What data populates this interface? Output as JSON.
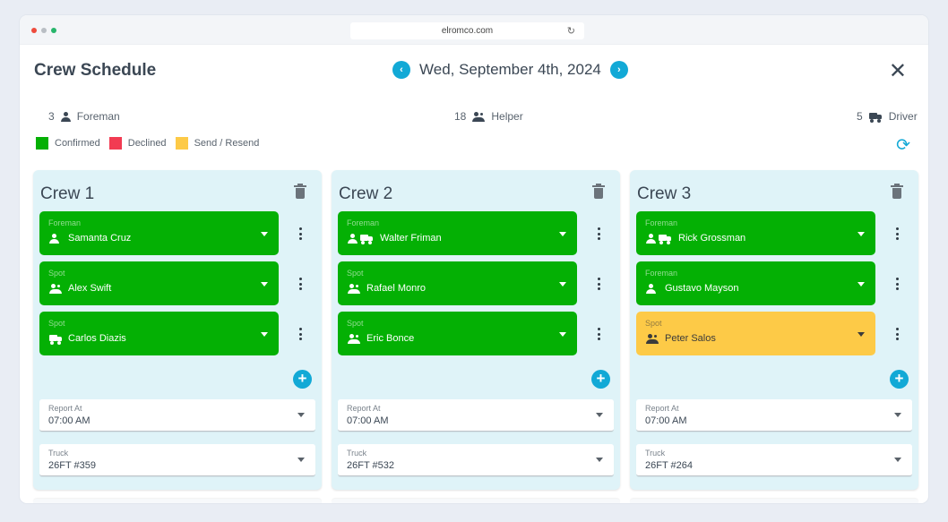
{
  "browser": {
    "url": "elromco.com",
    "dot_colors": [
      "#ee4b3d",
      "#b9bec4",
      "#27b56b"
    ]
  },
  "header": {
    "title": "Crew Schedule",
    "date": "Wed, September 4th, 2024",
    "prev_icon": "chevron-left",
    "next_icon": "chevron-right",
    "close_icon": "close"
  },
  "summary": {
    "foreman": {
      "count": "3",
      "label": "Foreman"
    },
    "helper": {
      "count": "18",
      "label": "Helper"
    },
    "driver": {
      "count": "5",
      "label": "Driver"
    }
  },
  "legend": [
    {
      "label": "Confirmed",
      "color": "#04b004"
    },
    {
      "label": "Declined",
      "color": "#f23b52"
    },
    {
      "label": "Send / Resend",
      "color": "#fdca47"
    }
  ],
  "colors": {
    "accent": "#12a9d6",
    "confirmed": "#04b004",
    "pending": "#fdca47",
    "crew_bg": "#dff3f8"
  },
  "crews": [
    {
      "name": "Crew 1",
      "members": [
        {
          "role": "Foreman",
          "name": "Samanta Cruz",
          "icons": [
            "person"
          ],
          "status": "confirmed"
        },
        {
          "role": "Spot",
          "name": "Alex Swift",
          "icons": [
            "people"
          ],
          "status": "confirmed"
        },
        {
          "role": "Spot",
          "name": "Carlos Diazis",
          "icons": [
            "truck"
          ],
          "status": "confirmed"
        }
      ],
      "report_at": {
        "label": "Report At",
        "value": "07:00 AM"
      },
      "truck": {
        "label": "Truck",
        "value": "26FT #359"
      }
    },
    {
      "name": "Crew 2",
      "members": [
        {
          "role": "Foreman",
          "name": "Walter Friman",
          "icons": [
            "person",
            "truck"
          ],
          "status": "confirmed"
        },
        {
          "role": "Spot",
          "name": "Rafael Monro",
          "icons": [
            "people"
          ],
          "status": "confirmed"
        },
        {
          "role": "Spot",
          "name": "Eric Bonce",
          "icons": [
            "people"
          ],
          "status": "confirmed"
        }
      ],
      "report_at": {
        "label": "Report At",
        "value": "07:00 AM"
      },
      "truck": {
        "label": "Truck",
        "value": "26FT #532"
      }
    },
    {
      "name": "Crew 3",
      "members": [
        {
          "role": "Foreman",
          "name": "Rick Grossman",
          "icons": [
            "person",
            "truck"
          ],
          "status": "confirmed"
        },
        {
          "role": "Foreman",
          "name": "Gustavo Mayson",
          "icons": [
            "person"
          ],
          "status": "confirmed"
        },
        {
          "role": "Spot",
          "name": "Peter Salos",
          "icons": [
            "people"
          ],
          "status": "pending"
        }
      ],
      "report_at": {
        "label": "Report At",
        "value": "07:00 AM"
      },
      "truck": {
        "label": "Truck",
        "value": "26FT #264"
      }
    }
  ]
}
